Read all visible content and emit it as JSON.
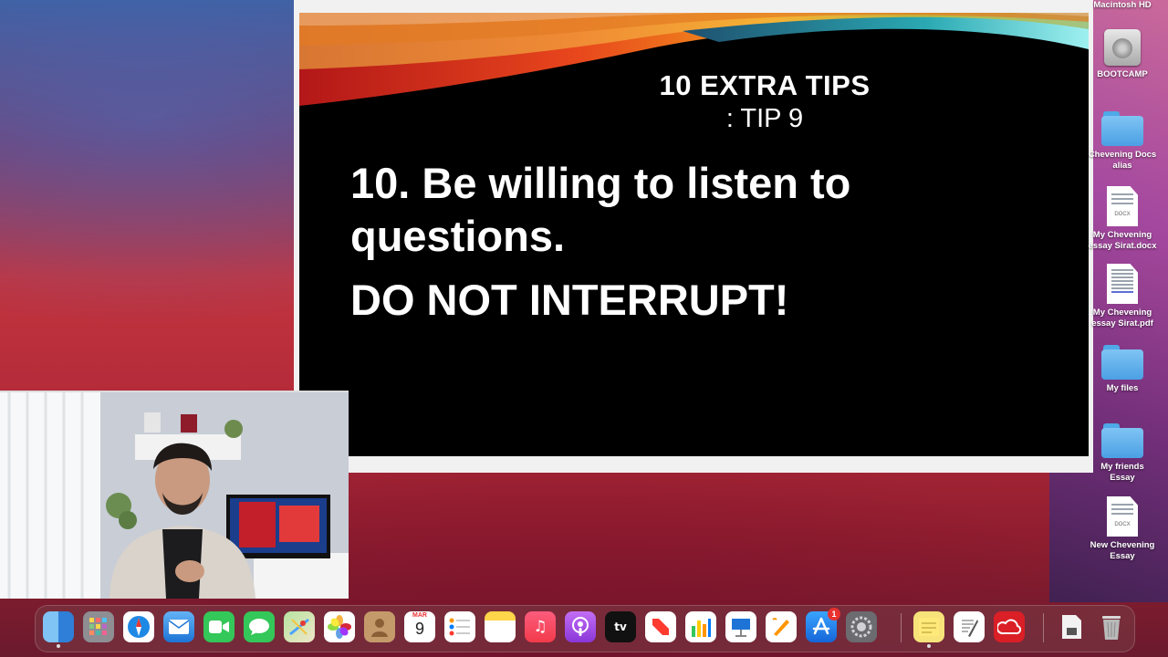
{
  "slide": {
    "heading": "10 EXTRA TIPS",
    "subheading": ": TIP 9",
    "body_line": "10. Be willing to listen to questions.",
    "emphasis": "DO NOT INTERRUPT!"
  },
  "desktop": {
    "items": [
      {
        "label": "Macintosh HD",
        "icon": "hard-drive-icon"
      },
      {
        "label": "BOOTCAMP",
        "icon": "hard-drive-icon"
      },
      {
        "label": "Chevening Docs alias",
        "icon": "folder-icon"
      },
      {
        "label": "My Chevening essay Sirat.docx",
        "icon": "docx-icon",
        "tag": "DOCX"
      },
      {
        "label": "My Chevening essay Sirat.pdf",
        "icon": "pdf-icon"
      },
      {
        "label": "My files",
        "icon": "folder-icon"
      },
      {
        "label": "My friends Essay",
        "icon": "folder-icon"
      },
      {
        "label": "New Chevening Essay",
        "icon": "docx-icon",
        "tag": "DOCX"
      }
    ]
  },
  "dock": {
    "calendar_month": "MAR",
    "calendar_day": "9",
    "appletv_label": "tv",
    "appstore_badge": "1",
    "apps": [
      "Finder",
      "Launchpad",
      "Safari",
      "Mail",
      "FaceTime",
      "Messages",
      "Maps",
      "Photos",
      "Contacts",
      "Calendar",
      "Reminders",
      "Notes",
      "Music",
      "Podcasts",
      "TV",
      "News",
      "Numbers",
      "Keynote",
      "Pages",
      "App Store",
      "System Preferences",
      "Stickies",
      "TextEdit",
      "Creative Cloud",
      "Downloads",
      "Trash"
    ]
  },
  "colors": {
    "slide_bg": "#000000",
    "slide_text": "#ffffff",
    "accent_red": "#d9272b",
    "accent_teal": "#3ac6c9"
  }
}
